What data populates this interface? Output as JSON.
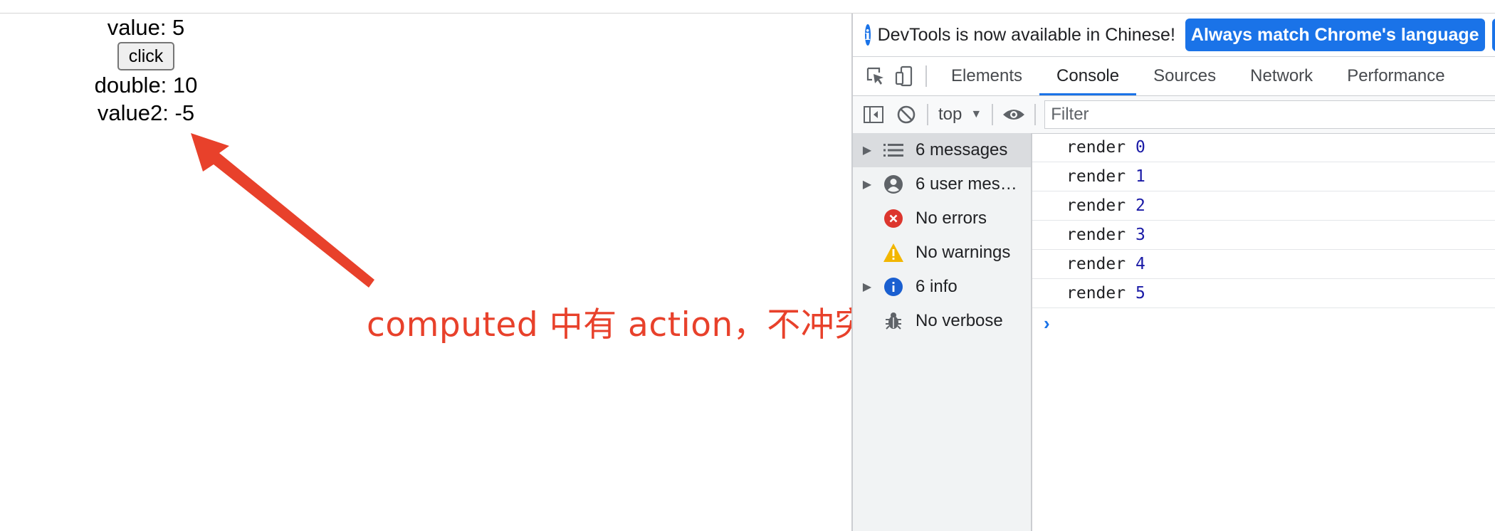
{
  "page": {
    "value_label": "value: 5",
    "button_label": "click",
    "double_label": "double: 10",
    "value2_label": "value2: -5",
    "annotation": "computed 中有 action，不冲突",
    "annotation_color": "#e8412b"
  },
  "devtools": {
    "infobar": {
      "message": "DevTools is now available in Chinese!",
      "primary_button": "Always match Chrome's language",
      "secondary_button": "Sw"
    },
    "tabs": [
      {
        "label": "Elements",
        "active": false
      },
      {
        "label": "Console",
        "active": true
      },
      {
        "label": "Sources",
        "active": false
      },
      {
        "label": "Network",
        "active": false
      },
      {
        "label": "Performance",
        "active": false
      }
    ],
    "toolbar": {
      "context": "top",
      "filter_placeholder": "Filter"
    },
    "sidebar": [
      {
        "label": "6 messages",
        "icon": "list-icon",
        "expandable": true,
        "selected": true
      },
      {
        "label": "6 user mes…",
        "icon": "user-icon",
        "expandable": true,
        "selected": false
      },
      {
        "label": "No errors",
        "icon": "error-icon",
        "expandable": false,
        "selected": false
      },
      {
        "label": "No warnings",
        "icon": "warning-icon",
        "expandable": false,
        "selected": false
      },
      {
        "label": "6 info",
        "icon": "info-icon",
        "expandable": true,
        "selected": false
      },
      {
        "label": "No verbose",
        "icon": "bug-icon",
        "expandable": false,
        "selected": false
      }
    ],
    "logs": [
      {
        "text": "render",
        "num": "0"
      },
      {
        "text": "render",
        "num": "1"
      },
      {
        "text": "render",
        "num": "2"
      },
      {
        "text": "render",
        "num": "3"
      },
      {
        "text": "render",
        "num": "4"
      },
      {
        "text": "render",
        "num": "5"
      }
    ],
    "prompt": "›"
  }
}
